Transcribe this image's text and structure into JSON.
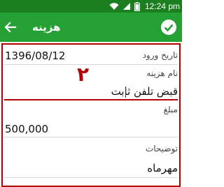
{
  "status_bar": {
    "time": "12:24 pm"
  },
  "app_bar": {
    "title": "هزینه"
  },
  "form": {
    "entry_date": {
      "label": "تاریخ ورود",
      "value": "1396/08/12"
    },
    "expense_name": {
      "label": "نام هزینه",
      "value": "قبض تلفن ثابت"
    },
    "amount": {
      "label": "مبلغ",
      "value": "500,000"
    },
    "description": {
      "label": "توضیحات",
      "value": "مهرماه"
    }
  },
  "annotation": {
    "step_number": "۲"
  },
  "colors": {
    "status_bar": "#1b7e1f",
    "app_bar": "#25a035",
    "highlight": "#b00000"
  }
}
